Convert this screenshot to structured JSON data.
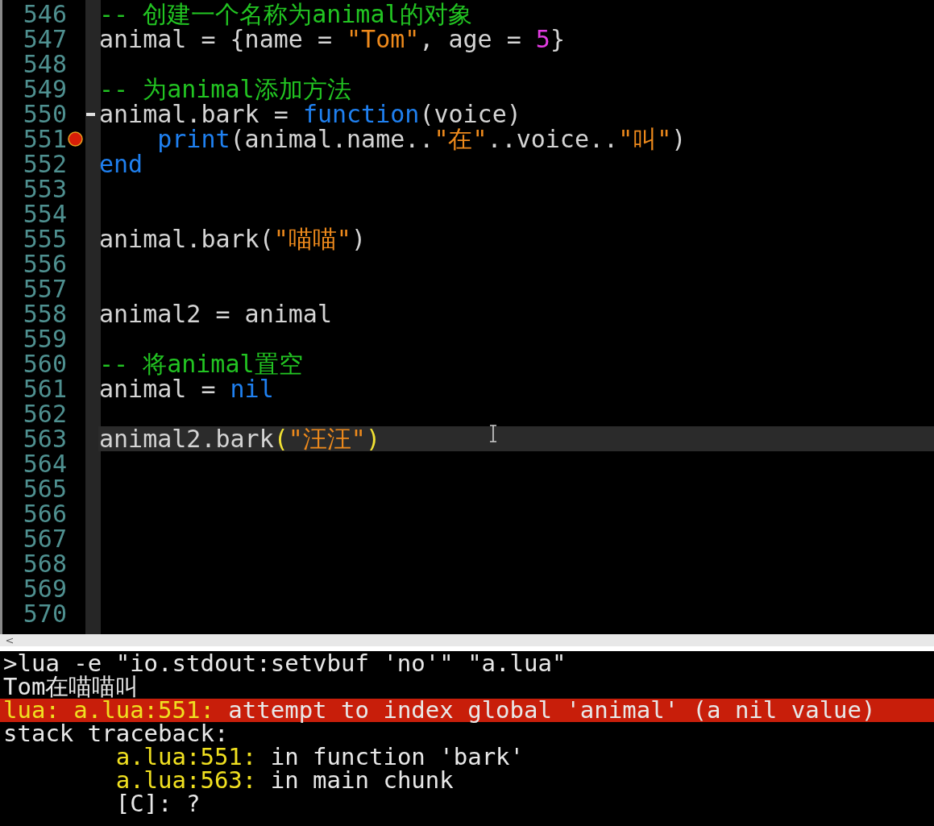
{
  "editor": {
    "lines": [
      {
        "number": "546",
        "current": false,
        "breakpoint": false,
        "fold_point": false,
        "tokens": [
          {
            "kind": "comment",
            "text": "-- 创建一个名称为animal的对象"
          }
        ]
      },
      {
        "number": "547",
        "current": false,
        "breakpoint": false,
        "fold_point": false,
        "tokens": [
          {
            "kind": "plain",
            "text": "animal = {name = "
          },
          {
            "kind": "string",
            "text": "\"Tom\""
          },
          {
            "kind": "plain",
            "text": ", age = "
          },
          {
            "kind": "number",
            "text": "5"
          },
          {
            "kind": "plain",
            "text": "}"
          }
        ]
      },
      {
        "number": "548",
        "current": false,
        "breakpoint": false,
        "fold_point": false
      },
      {
        "number": "549",
        "current": false,
        "breakpoint": false,
        "fold_point": false,
        "tokens": [
          {
            "kind": "comment",
            "text": "-- 为animal添加方法"
          }
        ]
      },
      {
        "number": "550",
        "current": false,
        "breakpoint": false,
        "fold_point": true,
        "tokens": [
          {
            "kind": "plain",
            "text": "animal.bark = "
          },
          {
            "kind": "keyword",
            "text": "function"
          },
          {
            "kind": "plain",
            "text": "(voice)"
          }
        ]
      },
      {
        "number": "551",
        "current": false,
        "breakpoint": true,
        "fold_point": false,
        "tokens": [
          {
            "kind": "keyword",
            "text": "    print"
          },
          {
            "kind": "plain",
            "text": "(animal.name.."
          },
          {
            "kind": "string",
            "text": "\"在\""
          },
          {
            "kind": "plain",
            "text": "..voice.."
          },
          {
            "kind": "string",
            "text": "\"叫\""
          },
          {
            "kind": "plain",
            "text": ")"
          }
        ]
      },
      {
        "number": "552",
        "current": false,
        "breakpoint": false,
        "fold_point": false,
        "tokens": [
          {
            "kind": "keyword",
            "text": "end"
          }
        ]
      },
      {
        "number": "553",
        "current": false,
        "breakpoint": false,
        "fold_point": false
      },
      {
        "number": "554",
        "current": false,
        "breakpoint": false,
        "fold_point": false
      },
      {
        "number": "555",
        "current": false,
        "breakpoint": false,
        "fold_point": false,
        "tokens": [
          {
            "kind": "plain",
            "text": "animal.bark("
          },
          {
            "kind": "string",
            "text": "\"喵喵\""
          },
          {
            "kind": "plain",
            "text": ")"
          }
        ]
      },
      {
        "number": "556",
        "current": false,
        "breakpoint": false,
        "fold_point": false
      },
      {
        "number": "557",
        "current": false,
        "breakpoint": false,
        "fold_point": false
      },
      {
        "number": "558",
        "current": false,
        "breakpoint": false,
        "fold_point": false,
        "tokens": [
          {
            "kind": "plain",
            "text": "animal2 = animal"
          }
        ]
      },
      {
        "number": "559",
        "current": false,
        "breakpoint": false,
        "fold_point": false
      },
      {
        "number": "560",
        "current": false,
        "breakpoint": false,
        "fold_point": false,
        "tokens": [
          {
            "kind": "comment",
            "text": "-- 将animal置空"
          }
        ]
      },
      {
        "number": "561",
        "current": false,
        "breakpoint": false,
        "fold_point": false,
        "tokens": [
          {
            "kind": "plain",
            "text": "animal = "
          },
          {
            "kind": "keyword",
            "text": "nil"
          }
        ]
      },
      {
        "number": "562",
        "current": false,
        "breakpoint": false,
        "fold_point": false
      },
      {
        "number": "563",
        "current": true,
        "breakpoint": false,
        "fold_point": false,
        "tokens": [
          {
            "kind": "plain",
            "text": "animal2.bark"
          },
          {
            "kind": "brace",
            "text": "("
          },
          {
            "kind": "string",
            "text": "\"汪汪\""
          },
          {
            "kind": "brace",
            "text": ")"
          }
        ]
      },
      {
        "number": "564",
        "current": false,
        "breakpoint": false,
        "fold_point": false
      },
      {
        "number": "565",
        "current": false,
        "breakpoint": false,
        "fold_point": false
      },
      {
        "number": "566",
        "current": false,
        "breakpoint": false,
        "fold_point": false
      },
      {
        "number": "567",
        "current": false,
        "breakpoint": false,
        "fold_point": false
      },
      {
        "number": "568",
        "current": false,
        "breakpoint": false,
        "fold_point": false
      },
      {
        "number": "569",
        "current": false,
        "breakpoint": false,
        "fold_point": false
      },
      {
        "number": "570",
        "current": false,
        "breakpoint": false,
        "fold_point": false
      }
    ]
  },
  "scrollbar": {
    "arrow": "<"
  },
  "output": {
    "lines": [
      {
        "kind": "plain",
        "segments": [
          {
            "kind": "text",
            "text": ">lua -e \"io.stdout:setvbuf 'no'\" \"a.lua\""
          }
        ]
      },
      {
        "kind": "plain",
        "segments": [
          {
            "kind": "text",
            "text": "Tom在喵喵叫"
          }
        ]
      },
      {
        "kind": "error",
        "segments": [
          {
            "kind": "location",
            "text": "lua: a.lua:551:"
          },
          {
            "kind": "text",
            "text": " attempt to index global 'animal' (a nil value)"
          }
        ]
      },
      {
        "kind": "plain",
        "segments": [
          {
            "kind": "text",
            "text": "stack traceback:"
          }
        ]
      },
      {
        "kind": "plain",
        "segments": [
          {
            "kind": "location",
            "text": "        a.lua:551:"
          },
          {
            "kind": "text",
            "text": " in function 'bark'"
          }
        ]
      },
      {
        "kind": "plain",
        "segments": [
          {
            "kind": "location",
            "text": "        a.lua:563:"
          },
          {
            "kind": "text",
            "text": " in main chunk"
          }
        ]
      },
      {
        "kind": "plain",
        "segments": [
          {
            "kind": "text",
            "text": "        [C]: ?"
          }
        ]
      }
    ]
  }
}
